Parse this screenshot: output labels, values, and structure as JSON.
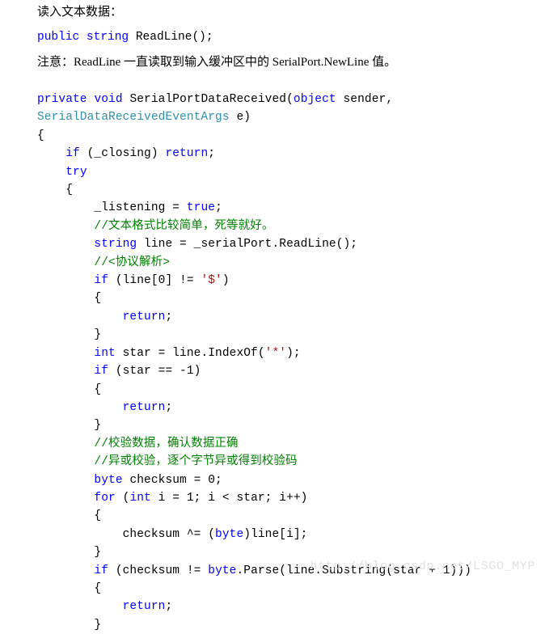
{
  "document": {
    "title_line": "读入文本数据：",
    "signature": {
      "kw_public": "public",
      "kw_string": "string",
      "rest": " ReadLine();"
    },
    "note_line": "注意：ReadLine 一直读取到输入缓冲区中的 SerialPort.NewLine 值。"
  },
  "colors": {
    "keyword": "#0000ff",
    "type": "#2b91af",
    "string": "#a31515",
    "comment": "#008000",
    "plain": "#000000",
    "background": "#ffffff",
    "watermark": "#e2e2e2"
  },
  "code": {
    "language": "csharp",
    "lines": [
      [
        {
          "t": "private",
          "c": "kw"
        },
        {
          "t": " ",
          "c": "plain"
        },
        {
          "t": "void",
          "c": "kw"
        },
        {
          "t": " SerialPortDataReceived(",
          "c": "plain"
        },
        {
          "t": "object",
          "c": "kw"
        },
        {
          "t": " sender,",
          "c": "plain"
        }
      ],
      [
        {
          "t": "SerialDataReceivedEventArgs",
          "c": "type-name"
        },
        {
          "t": " e)",
          "c": "plain"
        }
      ],
      [
        {
          "t": "{",
          "c": "plain"
        }
      ],
      [
        {
          "t": "    ",
          "c": "plain"
        },
        {
          "t": "if",
          "c": "kw"
        },
        {
          "t": " (_closing) ",
          "c": "plain"
        },
        {
          "t": "return",
          "c": "kw"
        },
        {
          "t": ";",
          "c": "plain"
        }
      ],
      [
        {
          "t": "    ",
          "c": "plain"
        },
        {
          "t": "try",
          "c": "kw"
        }
      ],
      [
        {
          "t": "    {",
          "c": "plain"
        }
      ],
      [
        {
          "t": "        _listening = ",
          "c": "plain"
        },
        {
          "t": "true",
          "c": "kw"
        },
        {
          "t": ";",
          "c": "plain"
        }
      ],
      [
        {
          "t": "        //文本格式比较简单，死等就好。",
          "c": "cmt"
        }
      ],
      [
        {
          "t": "        ",
          "c": "plain"
        },
        {
          "t": "string",
          "c": "kw"
        },
        {
          "t": " line = _serialPort.ReadLine();",
          "c": "plain"
        }
      ],
      [
        {
          "t": "        //<协议解析>",
          "c": "cmt"
        }
      ],
      [
        {
          "t": "        ",
          "c": "plain"
        },
        {
          "t": "if",
          "c": "kw"
        },
        {
          "t": " (line[0] != ",
          "c": "plain"
        },
        {
          "t": "'$'",
          "c": "str"
        },
        {
          "t": ")",
          "c": "plain"
        }
      ],
      [
        {
          "t": "        {",
          "c": "plain"
        }
      ],
      [
        {
          "t": "            ",
          "c": "plain"
        },
        {
          "t": "return",
          "c": "kw"
        },
        {
          "t": ";",
          "c": "plain"
        }
      ],
      [
        {
          "t": "        }",
          "c": "plain"
        }
      ],
      [
        {
          "t": "        ",
          "c": "plain"
        },
        {
          "t": "int",
          "c": "kw"
        },
        {
          "t": " star = line.IndexOf(",
          "c": "plain"
        },
        {
          "t": "'*'",
          "c": "str"
        },
        {
          "t": ");",
          "c": "plain"
        }
      ],
      [
        {
          "t": "        ",
          "c": "plain"
        },
        {
          "t": "if",
          "c": "kw"
        },
        {
          "t": " (star == -1)",
          "c": "plain"
        }
      ],
      [
        {
          "t": "        {",
          "c": "plain"
        }
      ],
      [
        {
          "t": "            ",
          "c": "plain"
        },
        {
          "t": "return",
          "c": "kw"
        },
        {
          "t": ";",
          "c": "plain"
        }
      ],
      [
        {
          "t": "        }",
          "c": "plain"
        }
      ],
      [
        {
          "t": "        //校验数据，确认数据正确",
          "c": "cmt"
        }
      ],
      [
        {
          "t": "        //异或校验，逐个字节异或得到校验码",
          "c": "cmt"
        }
      ],
      [
        {
          "t": "        ",
          "c": "plain"
        },
        {
          "t": "byte",
          "c": "kw"
        },
        {
          "t": " checksum = 0;",
          "c": "plain"
        }
      ],
      [
        {
          "t": "        ",
          "c": "plain"
        },
        {
          "t": "for",
          "c": "kw"
        },
        {
          "t": " (",
          "c": "plain"
        },
        {
          "t": "int",
          "c": "kw"
        },
        {
          "t": " i = 1; i < star; i++)",
          "c": "plain"
        }
      ],
      [
        {
          "t": "        {",
          "c": "plain"
        }
      ],
      [
        {
          "t": "            checksum ^= (",
          "c": "plain"
        },
        {
          "t": "byte",
          "c": "kw"
        },
        {
          "t": ")line[i];",
          "c": "plain"
        }
      ],
      [
        {
          "t": "        }",
          "c": "plain"
        }
      ],
      [
        {
          "t": "        ",
          "c": "plain"
        },
        {
          "t": "if",
          "c": "kw"
        },
        {
          "t": " (checksum != ",
          "c": "plain"
        },
        {
          "t": "byte",
          "c": "kw"
        },
        {
          "t": ".Parse(line.Substring(star + 1)))",
          "c": "plain"
        }
      ],
      [
        {
          "t": "        {",
          "c": "plain"
        }
      ],
      [
        {
          "t": "            ",
          "c": "plain"
        },
        {
          "t": "return",
          "c": "kw"
        },
        {
          "t": ";",
          "c": "plain"
        }
      ],
      [
        {
          "t": "        }",
          "c": "plain"
        }
      ]
    ]
  },
  "watermark": {
    "text": "http://blog.csdn.net/LSGO_MYP"
  }
}
